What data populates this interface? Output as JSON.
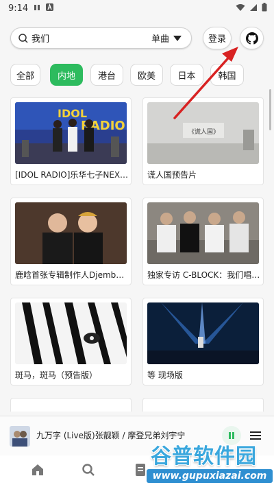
{
  "status_bar": {
    "time": "9:14",
    "icons": [
      "pause-icon",
      "A-icon",
      "wifi-icon",
      "signal-icon",
      "battery-icon"
    ]
  },
  "search": {
    "query": "我们",
    "type_label": "单曲"
  },
  "header": {
    "login_label": "登录"
  },
  "tabs": [
    {
      "label": "全部",
      "active": false
    },
    {
      "label": "内地",
      "active": true
    },
    {
      "label": "港台",
      "active": false
    },
    {
      "label": "欧美",
      "active": false
    },
    {
      "label": "日本",
      "active": false
    },
    {
      "label": "韩国",
      "active": false
    }
  ],
  "cards": [
    {
      "title": "[IDOL RADIO]乐华七子NEXT…"
    },
    {
      "title": "谎人国预告片"
    },
    {
      "title": "鹿晗首张专辑制作人Djemb…"
    },
    {
      "title": "独家专访 C-BLOCK：我们唱…"
    },
    {
      "title": "斑马，斑马（预告版）"
    },
    {
      "title": "等 现场版"
    }
  ],
  "player": {
    "now_playing": "九万字 (Live版)张靓颖 / 摩登兄弟刘宇宁"
  },
  "watermark": {
    "name": "谷普软件园",
    "url": "www.gupuxiazai.com"
  },
  "colors": {
    "accent": "#2dbb5e",
    "arrow": "#d82222"
  }
}
